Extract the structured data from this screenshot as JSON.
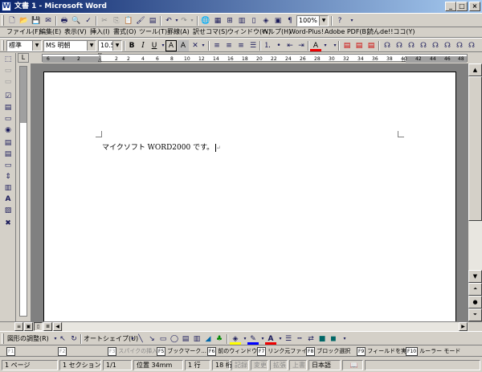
{
  "window": {
    "title": "文書 1 - Microsoft Word",
    "icon": "W"
  },
  "menu": [
    "ファイル(F)",
    "編集(E)",
    "表示(V)",
    "挿入(I)",
    "書式(O)",
    "ツール(T)",
    "罫線(A)",
    "訳せコマ(S)",
    "ウィンドウ(W)",
    "ヘルプ(H)",
    "Word-Plus!",
    "Adobe PDF(B)",
    "読んde!!ココ(Y)"
  ],
  "toolbar": {
    "zoom": "100%"
  },
  "format": {
    "style": "標準",
    "font": "MS 明朝",
    "size": "10.5",
    "bold": "B",
    "italic": "I",
    "underline": "U",
    "char_border": "A",
    "char_shade": "A",
    "font_color": "A"
  },
  "ruler": {
    "numbers": [
      "6",
      "4",
      "2",
      "2",
      "2",
      "4",
      "6",
      "8",
      "10",
      "12",
      "14",
      "16",
      "18",
      "20",
      "22",
      "24",
      "26",
      "28",
      "30",
      "32",
      "34",
      "36",
      "38",
      "40",
      "42",
      "44",
      "46",
      "48"
    ]
  },
  "document": {
    "text": "マイクソフト WORD2000 です。",
    "return_mark": "↵"
  },
  "drawing": {
    "draw_menu": "図形の調整(R)",
    "autoshape": "オートシェイプ(U)",
    "text_icon": "A"
  },
  "fkeys": [
    {
      "key": "F1",
      "label": "",
      "disabled": true
    },
    {
      "key": "F2",
      "label": "",
      "disabled": true
    },
    {
      "key": "F3",
      "label": "スパイクの挿入",
      "disabled": true
    },
    {
      "key": "F5",
      "label": "ブックマーク...",
      "disabled": false
    },
    {
      "key": "F6",
      "label": "前のウィンドウ",
      "disabled": false
    },
    {
      "key": "F7",
      "label": "リンク元ファイ...",
      "disabled": false
    },
    {
      "key": "F8",
      "label": "ブロック選択",
      "disabled": false
    },
    {
      "key": "F9",
      "label": "フィールドを実...",
      "disabled": false
    },
    {
      "key": "F10",
      "label": "ルーラー モード",
      "disabled": false
    }
  ],
  "status": {
    "page": "1 ページ",
    "section": "1 セクション",
    "pages": "1/1",
    "position": "位置 34mm",
    "line": "1 行",
    "col": "18 桁",
    "rec": "記録",
    "trk": "変更",
    "ext": "拡張",
    "ovr": "上書",
    "lang": "日本語"
  }
}
